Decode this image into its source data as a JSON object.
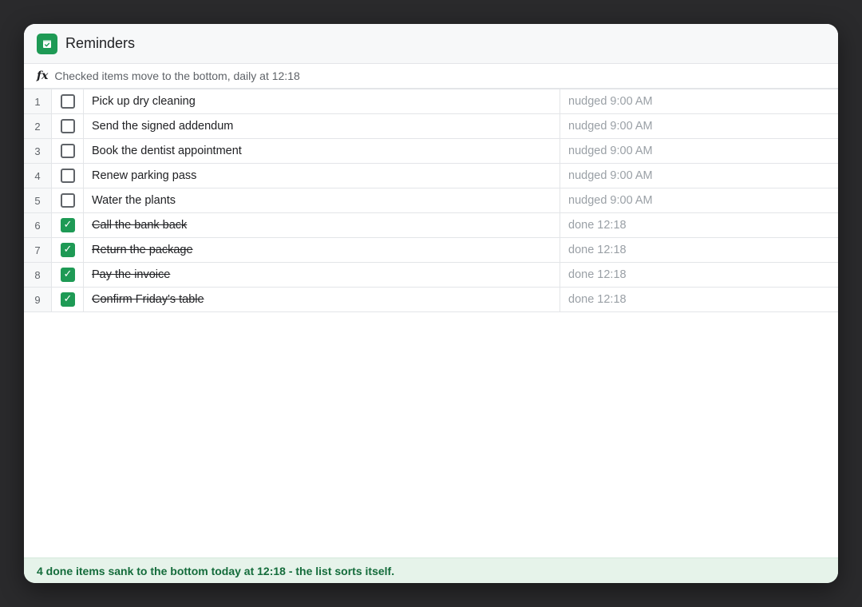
{
  "app": {
    "title": "Reminders",
    "icon": "calendar-check-icon",
    "accent_color": "#1e9a55"
  },
  "formula_bar": {
    "label": "fx",
    "text": "Checked items move to the bottom, daily at 12:18"
  },
  "rows": [
    {
      "num": "1",
      "checked": false,
      "task": "Pick up dry cleaning",
      "status": "nudged 9:00 AM"
    },
    {
      "num": "2",
      "checked": false,
      "task": "Send the signed addendum",
      "status": "nudged 9:00 AM"
    },
    {
      "num": "3",
      "checked": false,
      "task": "Book the dentist appointment",
      "status": "nudged 9:00 AM"
    },
    {
      "num": "4",
      "checked": false,
      "task": "Renew parking pass",
      "status": "nudged 9:00 AM"
    },
    {
      "num": "5",
      "checked": false,
      "task": "Water the plants",
      "status": "nudged 9:00 AM"
    },
    {
      "num": "6",
      "checked": true,
      "task": "Call the bank back",
      "status": "done 12:18"
    },
    {
      "num": "7",
      "checked": true,
      "task": "Return the package",
      "status": "done 12:18"
    },
    {
      "num": "8",
      "checked": true,
      "task": "Pay the invoice",
      "status": "done 12:18"
    },
    {
      "num": "9",
      "checked": true,
      "task": "Confirm Friday's table",
      "status": "done 12:18"
    }
  ],
  "footer": {
    "text": "4 done items sank to the bottom today at 12:18 - the list sorts itself."
  }
}
